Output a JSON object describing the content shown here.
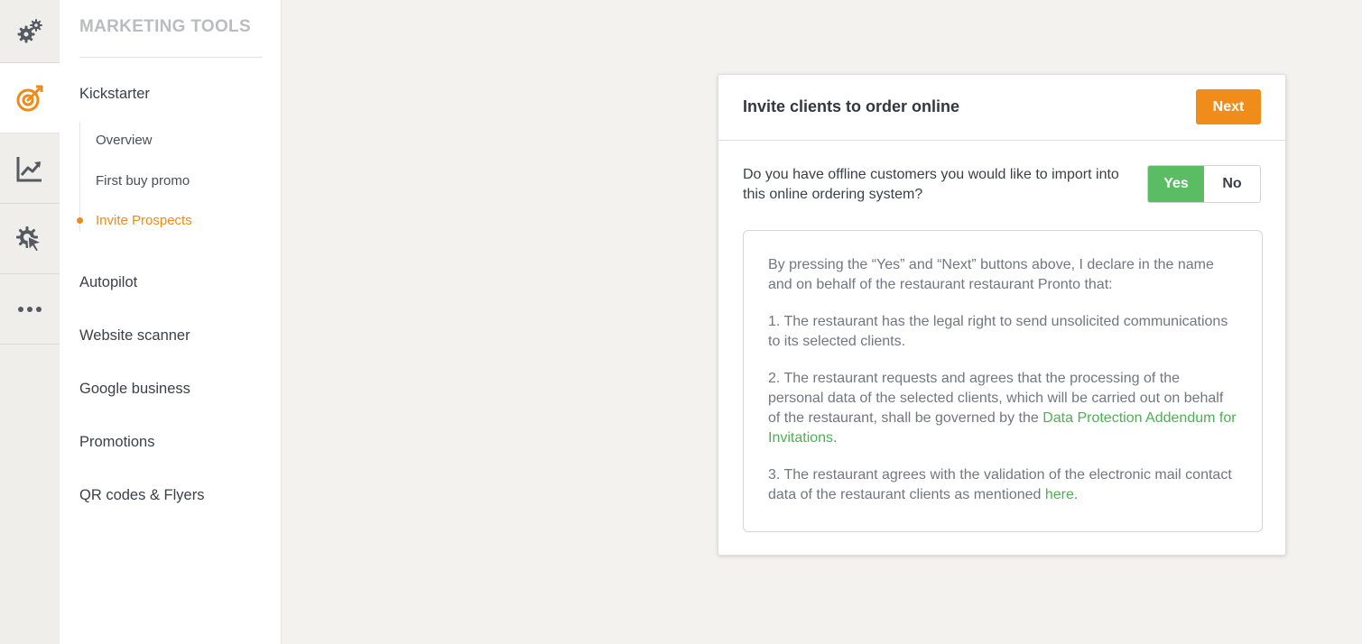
{
  "rail": {
    "items": [
      {
        "icon": "gears-icon",
        "active": false
      },
      {
        "icon": "target-icon",
        "active": true
      },
      {
        "icon": "chart-icon",
        "active": false
      },
      {
        "icon": "cog-cursor-icon",
        "active": false
      },
      {
        "icon": "more-icon",
        "active": false
      }
    ]
  },
  "menu": {
    "title": "MARKETING TOOLS",
    "kickstarter": "Kickstarter",
    "sub_items": {
      "overview": "Overview",
      "first_buy_promo": "First buy promo",
      "invite_prospects": "Invite Prospects"
    },
    "autopilot": "Autopilot",
    "website_scanner": "Website scanner",
    "google_business": "Google business",
    "promotions": "Promotions",
    "qr_codes": "QR codes & Flyers"
  },
  "card": {
    "title": "Invite clients to order online",
    "next_label": "Next",
    "question": "Do you have offline customers you would like to import into this online ordering system?",
    "toggle": {
      "yes_label": "Yes",
      "no_label": "No",
      "selected": "Yes"
    },
    "notice": {
      "intro": "By pressing the “Yes” and “Next” buttons above, I declare in the name and on behalf of the restaurant restaurant Pronto that:",
      "point1": "1. The restaurant has the legal right to send unsolicited communications to its selected clients.",
      "point2_text": "2. The restaurant requests and agrees that the processing of the personal data of the selected clients, which will be carried out on behalf of the restaurant, shall be governed by the ",
      "point2_link": "Data Protection Addendum for Invitations",
      "point2_end": ".",
      "point3_text": "3. The restaurant agrees with the validation of the electronic mail contact data of the restaurant clients as mentioned ",
      "point3_link": "here",
      "point3_end": "."
    }
  },
  "colors": {
    "accent_orange": "#f08c1a",
    "yes_green": "#5bbd63",
    "link_green": "#4cb152",
    "background": "#f3f2ef"
  }
}
